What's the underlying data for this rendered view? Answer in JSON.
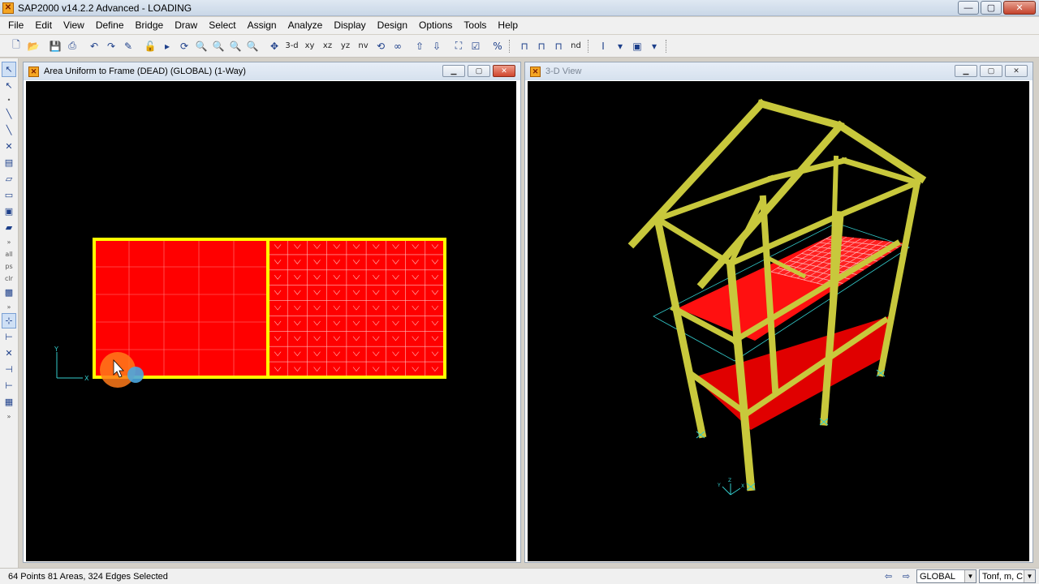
{
  "app": {
    "title": "SAP2000 v14.2.2 Advanced  - LOADING",
    "icon": "sap-logo-icon"
  },
  "window_controls": {
    "minimize": "—",
    "maximize": "▢",
    "close": "✕"
  },
  "menu": [
    "File",
    "Edit",
    "View",
    "Define",
    "Bridge",
    "Draw",
    "Select",
    "Assign",
    "Analyze",
    "Display",
    "Design",
    "Options",
    "Tools",
    "Help"
  ],
  "toolbar": {
    "view_3d": "3-d",
    "view_xy": "xy",
    "view_xz": "xz",
    "view_yz": "yz",
    "view_nv": "nv",
    "view_nd": "nd"
  },
  "left_window": {
    "title": "Area Uniform to Frame (DEAD) (GLOBAL) (1-Way)",
    "axis_x": "X",
    "axis_y": "Y"
  },
  "right_window": {
    "title": "3-D View",
    "axis_x": "X",
    "axis_y": "Y",
    "axis_z": "Z"
  },
  "left_toolbar": {
    "all": "all",
    "ps": "ps",
    "clr": "clr"
  },
  "status": {
    "text": "64 Points  81 Areas, 324 Edges Selected",
    "coord_system": "GLOBAL",
    "units": "Tonf, m, C"
  },
  "colors": {
    "canvas_bg": "#000000",
    "area_fill": "#ff0000",
    "frame": "#ffff00",
    "frame_3d": "#c8c83c",
    "grid": "#ffd0d0"
  }
}
